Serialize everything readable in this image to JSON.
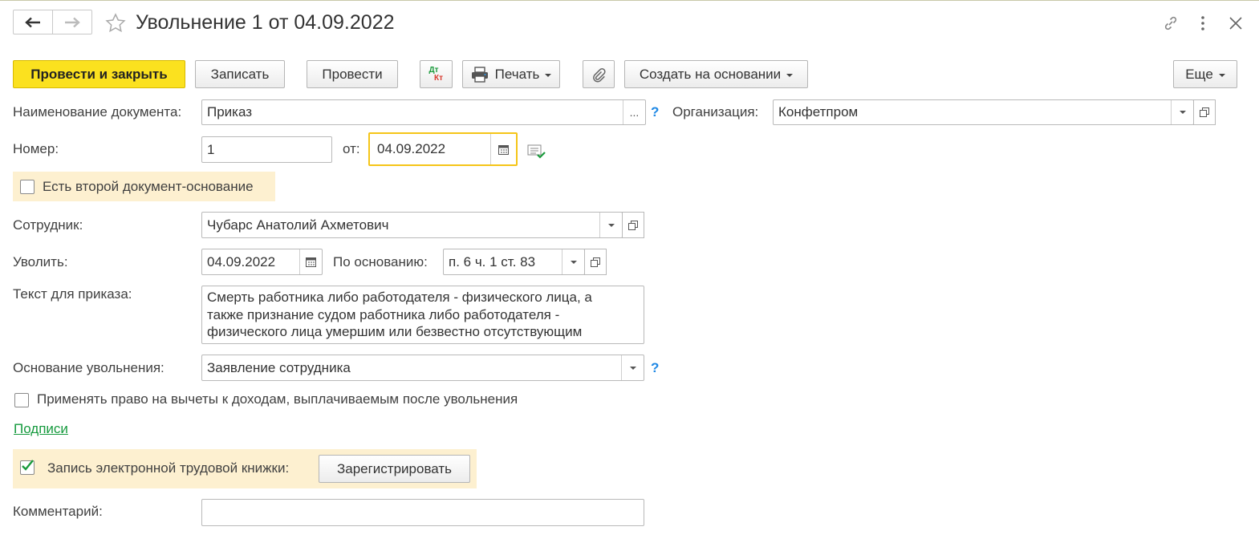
{
  "window": {
    "title": "Увольнение 1 от 04.09.2022"
  },
  "toolbar": {
    "post_and_close": "Провести и закрыть",
    "save": "Записать",
    "post": "Провести",
    "dtkt_dt": "Дт",
    "dtkt_kt": "Кт",
    "print": "Печать",
    "create_based_on": "Создать на основании",
    "more": "Еще"
  },
  "form": {
    "doc_name_label": "Наименование документа:",
    "doc_name_value": "Приказ",
    "doc_name_dots": "...",
    "help_mark": "?",
    "org_label": "Организация:",
    "org_value": "Конфетпром",
    "number_label": "Номер:",
    "number_value": "1",
    "date_label": "от:",
    "date_value": "04.09.2022",
    "second_basis_label": "Есть второй документ-основание",
    "second_basis_checked": false,
    "employee_label": "Сотрудник:",
    "employee_value": "Чубарс Анатолий Ахметович",
    "dismiss_label": "Уволить:",
    "dismiss_date": "04.09.2022",
    "basis_label": "По основанию:",
    "basis_value": "п. 6 ч. 1 ст. 83",
    "order_text_label": "Текст для приказа:",
    "order_text_lines": [
      "Смерть работника либо работодателя - физического лица, а",
      "также признание судом работника либо работодателя -",
      "физического лица умершим или безвестно отсутствующим"
    ],
    "reason_label": "Основание увольнения:",
    "reason_value": "Заявление сотрудника",
    "deductions_label": "Применять право на вычеты к доходам, выплачиваемым после увольнения",
    "deductions_checked": false,
    "signatures_link": "Подписи",
    "etk_label": "Запись электронной трудовой книжки:",
    "etk_checked": true,
    "register_button": "Зарегистрировать",
    "comment_label": "Комментарий:",
    "comment_value": ""
  },
  "colors": {
    "primary_button": "#fbe11f",
    "highlight": "#fdf0d0",
    "link": "#169a3e",
    "help": "#1e88e5",
    "check": "#1a9a3c"
  }
}
